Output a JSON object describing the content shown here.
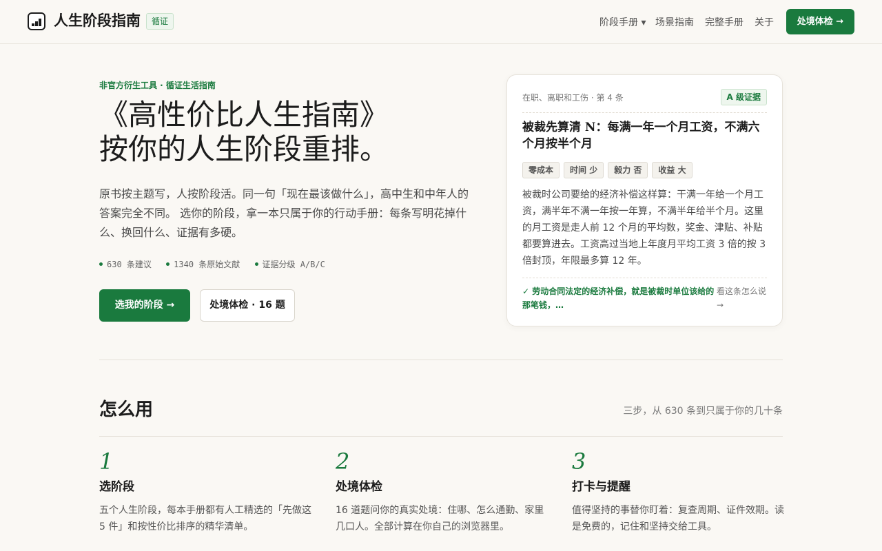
{
  "header": {
    "brand": "人生阶段指南",
    "badge": "循证",
    "nav": [
      "阶段手册 ▾",
      "场景指南",
      "完整手册",
      "关于"
    ],
    "cta": "处境体检 →"
  },
  "hero": {
    "eyebrow": "非官方衍生工具 · 循证生活指南",
    "title_line1": "《高性价比人生指南》",
    "title_line2": "按你的人生阶段重排。",
    "desc": "原书按主题写，人按阶段活。同一句「现在最该做什么」，高中生和中年人的答案完全不同。 选你的阶段，拿一本只属于你的行动手册：每条写明花掉什么、换回什么、证据有多硬。",
    "stats": [
      "630 条建议",
      "1340 条原始文献",
      "证据分级 A/B/C"
    ],
    "primary_button": "选我的阶段 →",
    "secondary_button": "处境体检 · 16 题"
  },
  "card": {
    "meta": "在职、离职和工伤 · 第 4 条",
    "grade": "A 级证据",
    "title": "被裁先算清 N：每满一年一个月工资，不满六个月按半个月",
    "tags": [
      "零成本",
      "时间 少",
      "毅力 否",
      "收益 大"
    ],
    "body": "被裁时公司要给的经济补偿这样算：干满一年给一个月工资，满半年不满一年按一年算，不满半年给半个月。这里的月工资是走人前 12 个月的平均数，奖金、津贴、补贴都要算进去。工资高过当地上年度月平均工资 3 倍的按 3 倍封顶，年限最多算 12 年。",
    "quote": "✓ 劳动合同法定的经济补偿，就是被裁时单位该给的那笔钱，…",
    "more": "看这条怎么说 →"
  },
  "how": {
    "title": "怎么用",
    "subtitle": "三步，从 630 条到只属于你的几十条",
    "steps": [
      {
        "num": "1",
        "title": "选阶段",
        "desc": "五个人生阶段，每本手册都有人工精选的「先做这 5 件」和按性价比排序的精华清单。"
      },
      {
        "num": "2",
        "title": "处境体检",
        "desc": "16 道题问你的真实处境：住哪、怎么通勤、家里几口人。全部计算在你自己的浏览器里。"
      },
      {
        "num": "3",
        "title": "打卡与提醒",
        "desc": "值得坚持的事替你盯着：复查周期、证件效期。读是免费的，记住和坚持交给工具。"
      }
    ]
  },
  "colors": {
    "accent": "#1a7a3e",
    "background": "#faf8f4"
  }
}
